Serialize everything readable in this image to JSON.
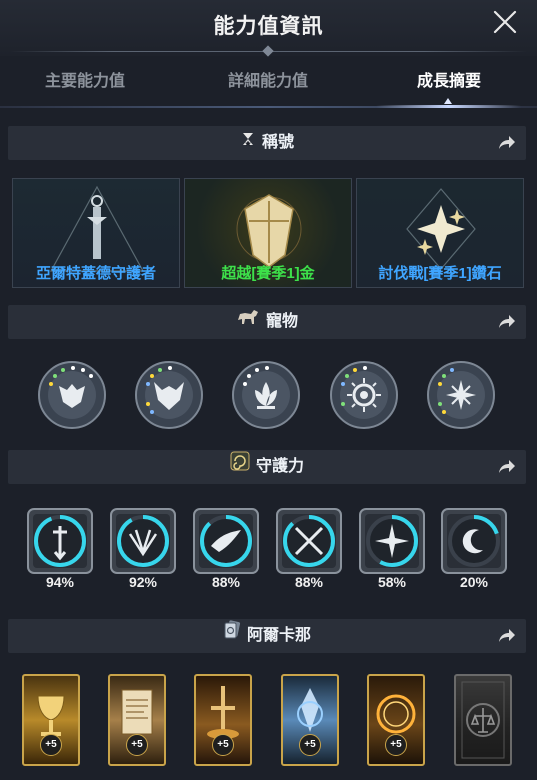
{
  "header": {
    "title": "能力值資訊"
  },
  "tabs": [
    {
      "label": "主要能力值",
      "active": false
    },
    {
      "label": "詳細能力值",
      "active": false
    },
    {
      "label": "成長摘要",
      "active": true
    }
  ],
  "sections": {
    "titles": {
      "label": "稱號",
      "icon": "hourglass-star-icon"
    },
    "pets": {
      "label": "寵物",
      "icon": "horse-icon"
    },
    "guardian": {
      "label": "守護力",
      "icon": "spiral-emblem-icon"
    },
    "arcana": {
      "label": "阿爾卡那",
      "icon": "card-icon"
    }
  },
  "title_cards": [
    {
      "label": "亞爾特蓋德守護者",
      "label_color": "#3fa5ff",
      "icon": "sword-triangle-icon"
    },
    {
      "label": "超越[賽季1]金",
      "label_color": "#3de04a",
      "icon": "gold-crest-icon"
    },
    {
      "label": "討伐戰[賽季1]鑽石",
      "label_color": "#3fa5ff",
      "icon": "diamond-star-icon"
    }
  ],
  "pets": [
    {
      "icon": "wolf-mask-icon"
    },
    {
      "icon": "horned-beast-icon"
    },
    {
      "icon": "lotus-icon"
    },
    {
      "icon": "sun-eye-icon"
    },
    {
      "icon": "leaf-star-icon"
    }
  ],
  "guardian": [
    {
      "percent": "94%",
      "value": 94,
      "icon": "shield-sword-icon"
    },
    {
      "percent": "92%",
      "value": 92,
      "icon": "fan-blades-icon"
    },
    {
      "percent": "88%",
      "value": 88,
      "icon": "bird-emblem-icon"
    },
    {
      "percent": "88%",
      "value": 88,
      "icon": "crossed-blades-icon"
    },
    {
      "percent": "58%",
      "value": 58,
      "icon": "compass-star-icon"
    },
    {
      "percent": "20%",
      "value": 20,
      "icon": "crescent-moon-icon"
    }
  ],
  "arcana": [
    {
      "badge": "+5",
      "icon": "golden-chalice-card-icon"
    },
    {
      "badge": "+5",
      "icon": "scroll-card-icon"
    },
    {
      "badge": "+5",
      "icon": "sword-card-icon"
    },
    {
      "badge": "+5",
      "icon": "ice-crystal-card-icon"
    },
    {
      "badge": "+5",
      "icon": "fire-ring-card-icon"
    },
    {
      "badge": "",
      "icon": "locked-scales-card-icon"
    }
  ],
  "colors": {
    "background": "#1c2029",
    "section_bg": "#2a2f39",
    "title_blue": "#3fa5ff",
    "title_green": "#3de04a",
    "guardian_ring": "#37d6ec",
    "gold": "#c9a44a"
  }
}
